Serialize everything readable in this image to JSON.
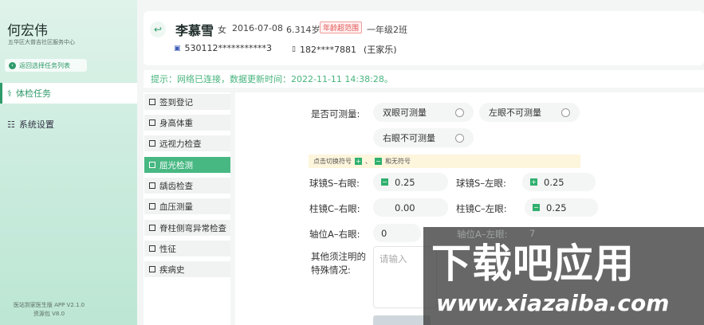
{
  "sidebar": {
    "user_name": "何宏伟",
    "org": "五华区大普吉社区服务中心",
    "back_label": "返回选择任务列表",
    "items": [
      {
        "label": "体检任务",
        "active": true
      },
      {
        "label": "系统设置",
        "active": false
      }
    ],
    "footer_app": "医站到家医生版 APP V2.1.0",
    "footer_res": "资源包 V8.0"
  },
  "patient": {
    "name": "李慕雪",
    "gender": "女",
    "birth": "2016-07-08",
    "age": "6.314岁",
    "age_badge": "年龄超范围",
    "grade": "一年级2班",
    "id_number": "530112***********3",
    "phone": "182****7881",
    "guardian": "(王家乐)"
  },
  "tip": "提示：网络已连接，数据更新时间：2022-11-11  14:38:28。",
  "nav": [
    {
      "label": "签到登记",
      "active": false
    },
    {
      "label": "身高体重",
      "active": false
    },
    {
      "label": "远视力检查",
      "active": false
    },
    {
      "label": "屈光检测",
      "active": true
    },
    {
      "label": "龋齿检查",
      "active": false
    },
    {
      "label": "血压测量",
      "active": false
    },
    {
      "label": "脊柱侧弯异常检查",
      "active": false
    },
    {
      "label": "性征",
      "active": false
    },
    {
      "label": "疾病史",
      "active": false
    }
  ],
  "form": {
    "measurable_label": "是否可测量:",
    "options": [
      "双眼可测量",
      "左眼不可测量",
      "右眼不可测量"
    ],
    "hint_prefix": "点击切换符号",
    "hint_sep": "、",
    "hint_suffix": "和无符号",
    "sphere_right_label": "球镜S–右眼:",
    "sphere_right_sign": "−",
    "sphere_right_value": "0.25",
    "sphere_left_label": "球镜S–左眼:",
    "sphere_left_sign": "+",
    "sphere_left_value": "0.25",
    "cyl_right_label": "柱镜C–右眼:",
    "cyl_right_value": "0.00",
    "cyl_left_label": "柱镜C–左眼:",
    "cyl_left_sign": "−",
    "cyl_left_value": "0.25",
    "axis_right_label": "轴位A–右眼:",
    "axis_right_value": "0",
    "axis_left_label": "轴位A–左眼:",
    "axis_left_value": "7",
    "notes_label_1": "其他须注明的",
    "notes_label_2": "特殊情况:",
    "notes_placeholder": "请输入"
  },
  "watermark": {
    "title": "下载吧应用",
    "url": "www.xiazaiba.com"
  },
  "colors": {
    "accent": "#2f9a6a",
    "nav_active": "#48b883",
    "tip_text": "#47b37c",
    "badge": "#e25252"
  }
}
